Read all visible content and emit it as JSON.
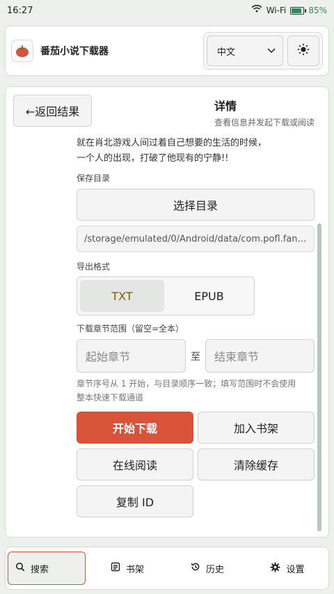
{
  "status_bar": {
    "time": "16:27",
    "network": "Wi-Fi",
    "battery": "85%",
    "battery_level": 0.85
  },
  "header": {
    "app_title": "番茄小说下载器",
    "language": "中文"
  },
  "detail": {
    "back_label": "←返回结果",
    "title": "详情",
    "subtitle": "查看信息并发起下载或阅读",
    "description_line1": "就在肖北游戏人间过着自己想要的生活的时候，",
    "description_line2": "一个人的出现，打破了他现有的宁静!!",
    "save_dir_label": "保存目录",
    "choose_dir_button": "选择目录",
    "save_path": "/storage/emulated/0/Android/data/com.pofl.fanqie…",
    "format_label": "导出格式",
    "formats": [
      "TXT",
      "EPUB"
    ],
    "selected_format": "TXT",
    "range_label": "下载章节范围（留空=全本）",
    "start_placeholder": "起始章节",
    "range_separator": "至",
    "end_placeholder": "结束章节",
    "hint_line1": "章节序号从 1 开始，与目录顺序一致；填写范围时不会使用",
    "hint_line2": "整本快速下载通道",
    "buttons": {
      "start_download": "开始下载",
      "add_to_shelf": "加入书架",
      "read_online": "在线阅读",
      "clear_cache": "清除缓存",
      "copy_id": "复制 ID"
    }
  },
  "nav": [
    {
      "label": "搜索",
      "icon": "search-icon"
    },
    {
      "label": "书架",
      "icon": "bookshelf-icon"
    },
    {
      "label": "历史",
      "icon": "history-icon"
    },
    {
      "label": "设置",
      "icon": "gear-icon"
    }
  ],
  "colors": {
    "accent": "#d9533b",
    "battery": "#2e8b57",
    "selected_format_text": "#7a5c10"
  }
}
